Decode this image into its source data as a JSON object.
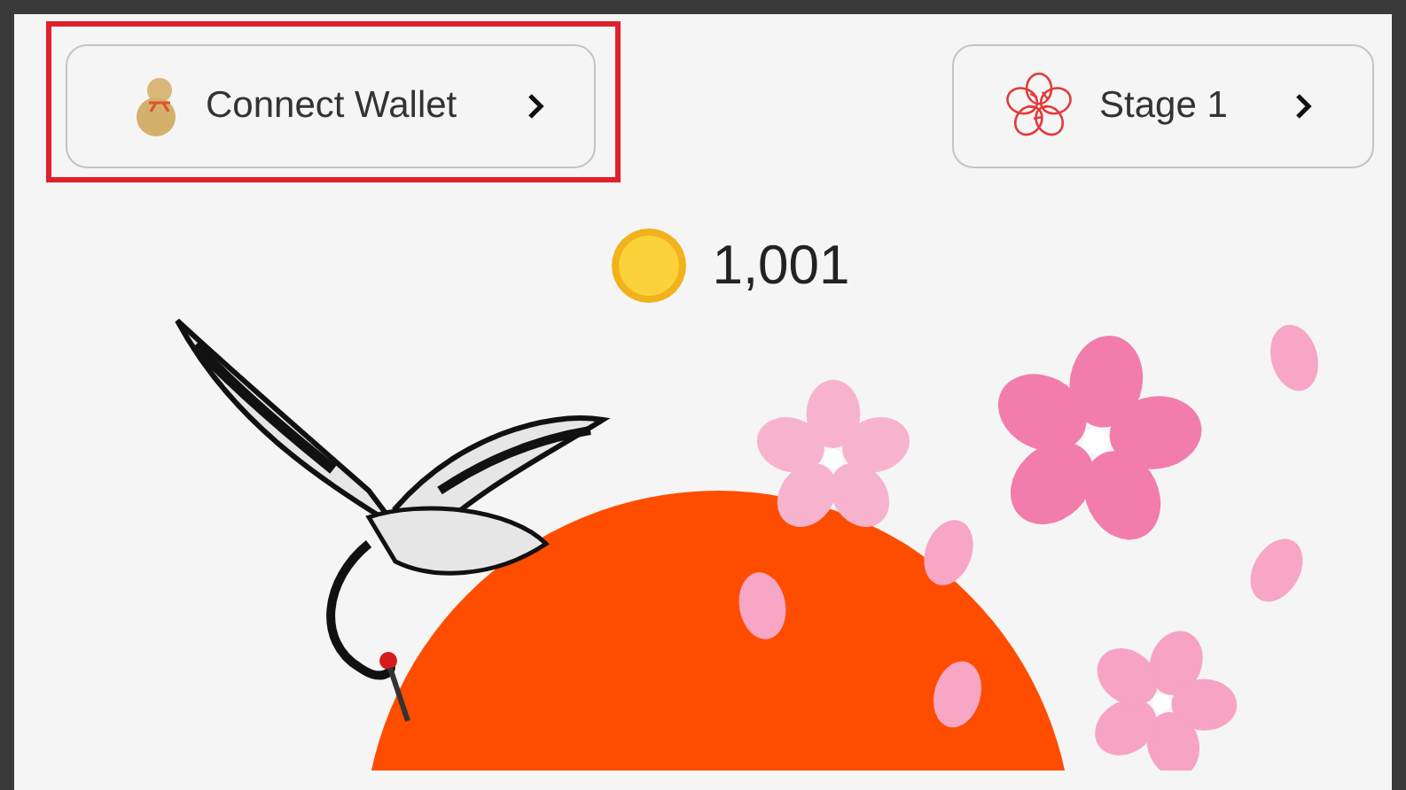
{
  "wallet_button": {
    "label": "Connect Wallet",
    "highlighted": true
  },
  "stage_button": {
    "label": "Stage 1"
  },
  "coins": {
    "amount": "1,001"
  }
}
